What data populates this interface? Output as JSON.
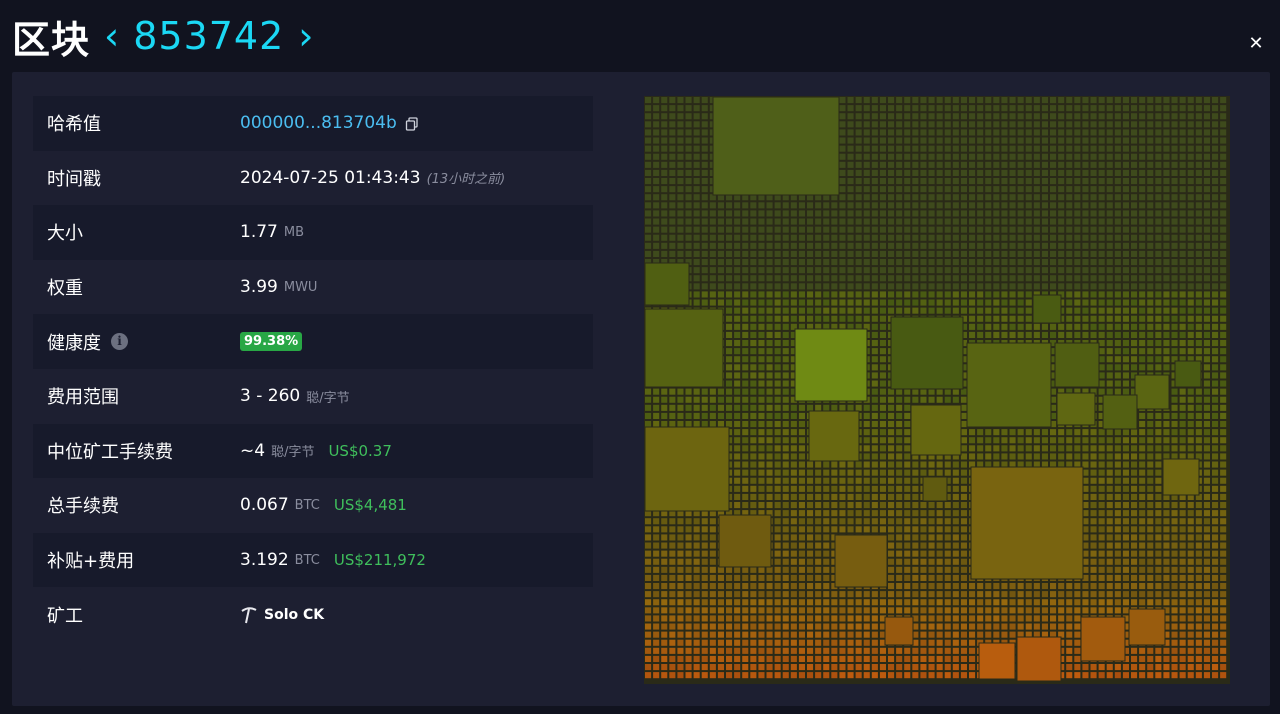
{
  "header": {
    "title": "区块",
    "block_height": "853742",
    "prev_arrow": "‹",
    "next_arrow": "›",
    "close": "✕"
  },
  "details": {
    "hash": {
      "label": "哈希值",
      "value": "000000...813704b"
    },
    "timestamp": {
      "label": "时间戳",
      "value": "2024-07-25 01:43:43",
      "ago": "(13小时之前)"
    },
    "size": {
      "label": "大小",
      "value": "1.77",
      "unit": "MB"
    },
    "weight": {
      "label": "权重",
      "value": "3.99",
      "unit": "MWU"
    },
    "health": {
      "label": "健康度",
      "value": "99.38%",
      "info": "i"
    },
    "fee_range": {
      "label": "费用范围",
      "value": "3 - 260",
      "unit": "聪/字节"
    },
    "median_fee": {
      "label": "中位矿工手续费",
      "value": "~4",
      "unit": "聪/字节",
      "fiat": "US$0.37"
    },
    "total_fees": {
      "label": "总手续费",
      "value": "0.067",
      "unit": "BTC",
      "fiat": "US$4,481"
    },
    "subsidy_fees": {
      "label": "补贴+费用",
      "value": "3.192",
      "unit": "BTC",
      "fiat": "US$211,972"
    },
    "miner": {
      "label": "矿工",
      "value": "Solo CK"
    }
  },
  "colors": {
    "accent": "#1bd8f4",
    "link": "#4bbdf0",
    "fiat": "#3fbf5c",
    "badge": "#28a745",
    "card": "#1d1f31",
    "background": "#11131f"
  }
}
